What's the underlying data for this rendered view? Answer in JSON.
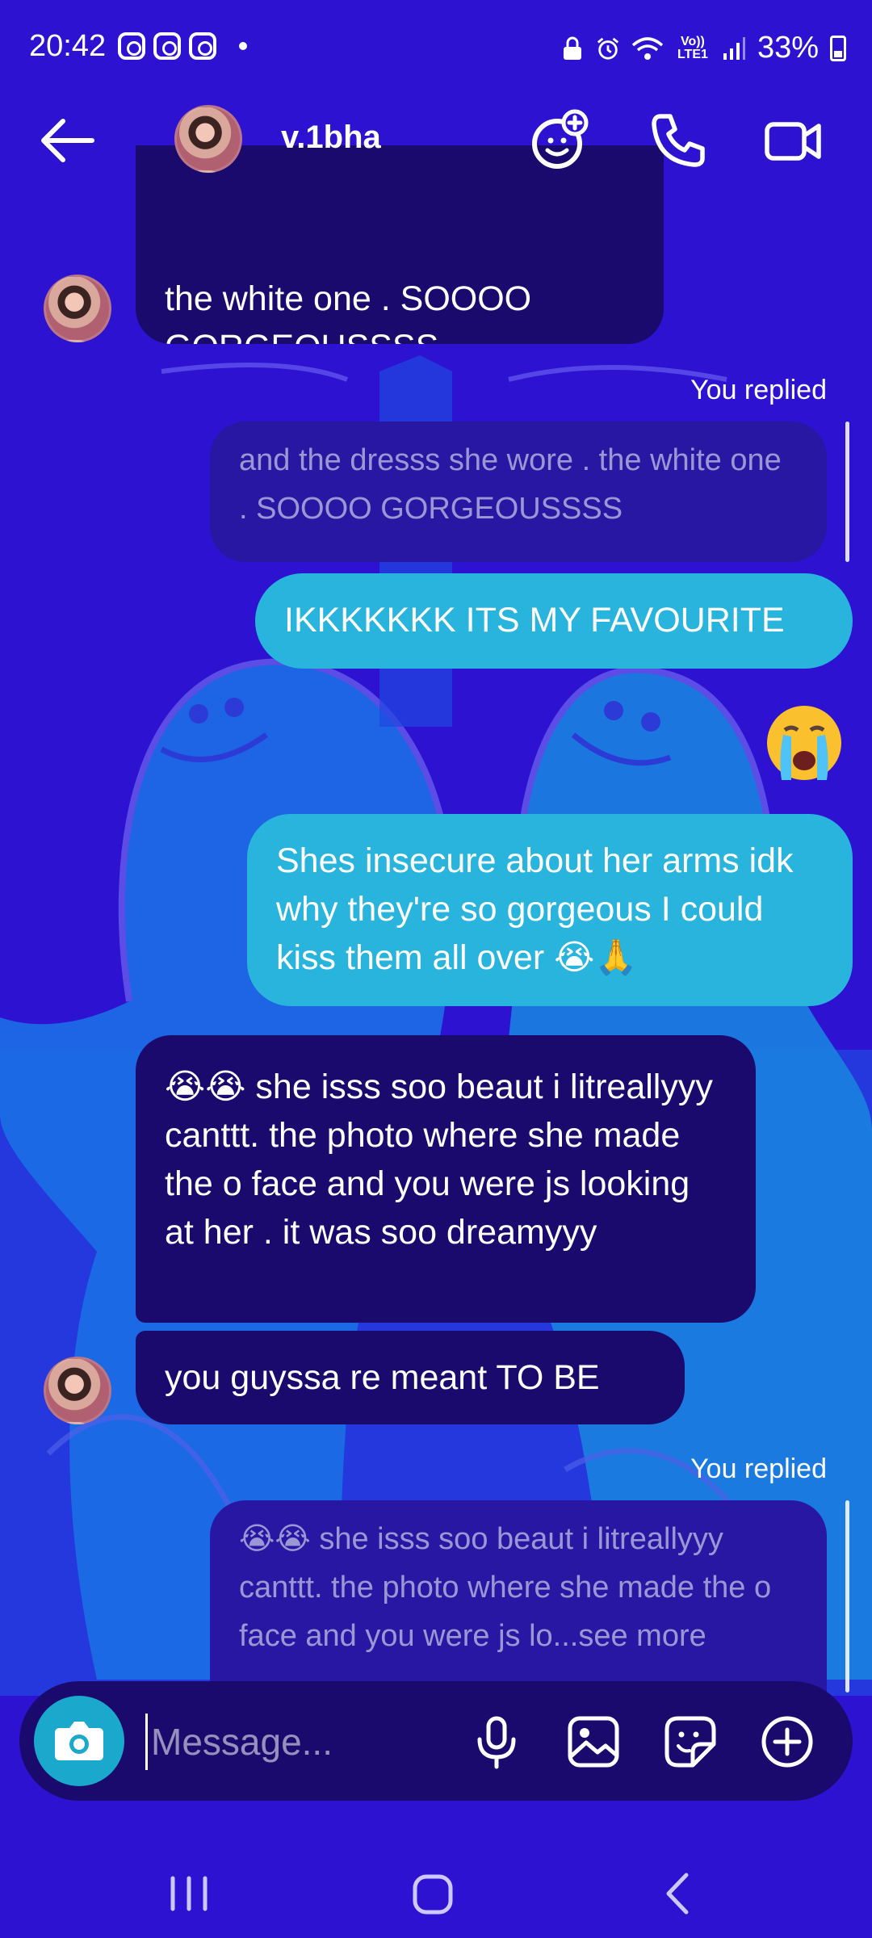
{
  "status_bar": {
    "time": "20:42",
    "network": "Vo)) LTE1",
    "battery": "33%"
  },
  "header": {
    "contact_name": "v.1bha"
  },
  "messages": [
    {
      "type": "incoming",
      "text": "and the dresss she wore . the white one . SOOOO GORGEOUSSSS",
      "visible_text": "the white one . SOOOO\nGORGEOUSSSS"
    },
    {
      "type": "reply_label",
      "text": "You replied"
    },
    {
      "type": "reply_quote",
      "text": "and the dresss she wore . the white one . SOOOO GORGEOUSSSS"
    },
    {
      "type": "outgoing",
      "text": "IKKKKKKK ITS MY FAVOURITE"
    },
    {
      "type": "emoji",
      "text": "😭"
    },
    {
      "type": "outgoing",
      "text": "Shes insecure about her arms idk why they're so gorgeous I could kiss them all over 😭🙏"
    },
    {
      "type": "incoming",
      "text": "😭😭 she isss soo beaut i litreallyyy canttt. the photo where she made the o face and you were js looking at her . it was soo dreamyyy"
    },
    {
      "type": "incoming",
      "text": "you guyssa re meant TO BE"
    },
    {
      "type": "reply_label",
      "text": "You replied"
    },
    {
      "type": "reply_quote",
      "text": "😭😭 she isss soo beaut i litreallyyy canttt. the photo where she made the o face and you were js lo...see more"
    }
  ],
  "composer": {
    "placeholder": "Message..."
  },
  "colors": {
    "background": "#2d12d2",
    "incoming_bubble": "#1a0a6e",
    "outgoing_bubble": "#28b4dc",
    "reply_quote": "#2717a3",
    "camera_button": "#1aa8cc"
  },
  "icons": [
    "back-arrow-icon",
    "effects-icon",
    "phone-icon",
    "video-camera-icon",
    "camera-icon",
    "microphone-icon",
    "gallery-icon",
    "sticker-icon",
    "plus-circle-icon",
    "recents-icon",
    "home-icon",
    "nav-back-icon"
  ]
}
